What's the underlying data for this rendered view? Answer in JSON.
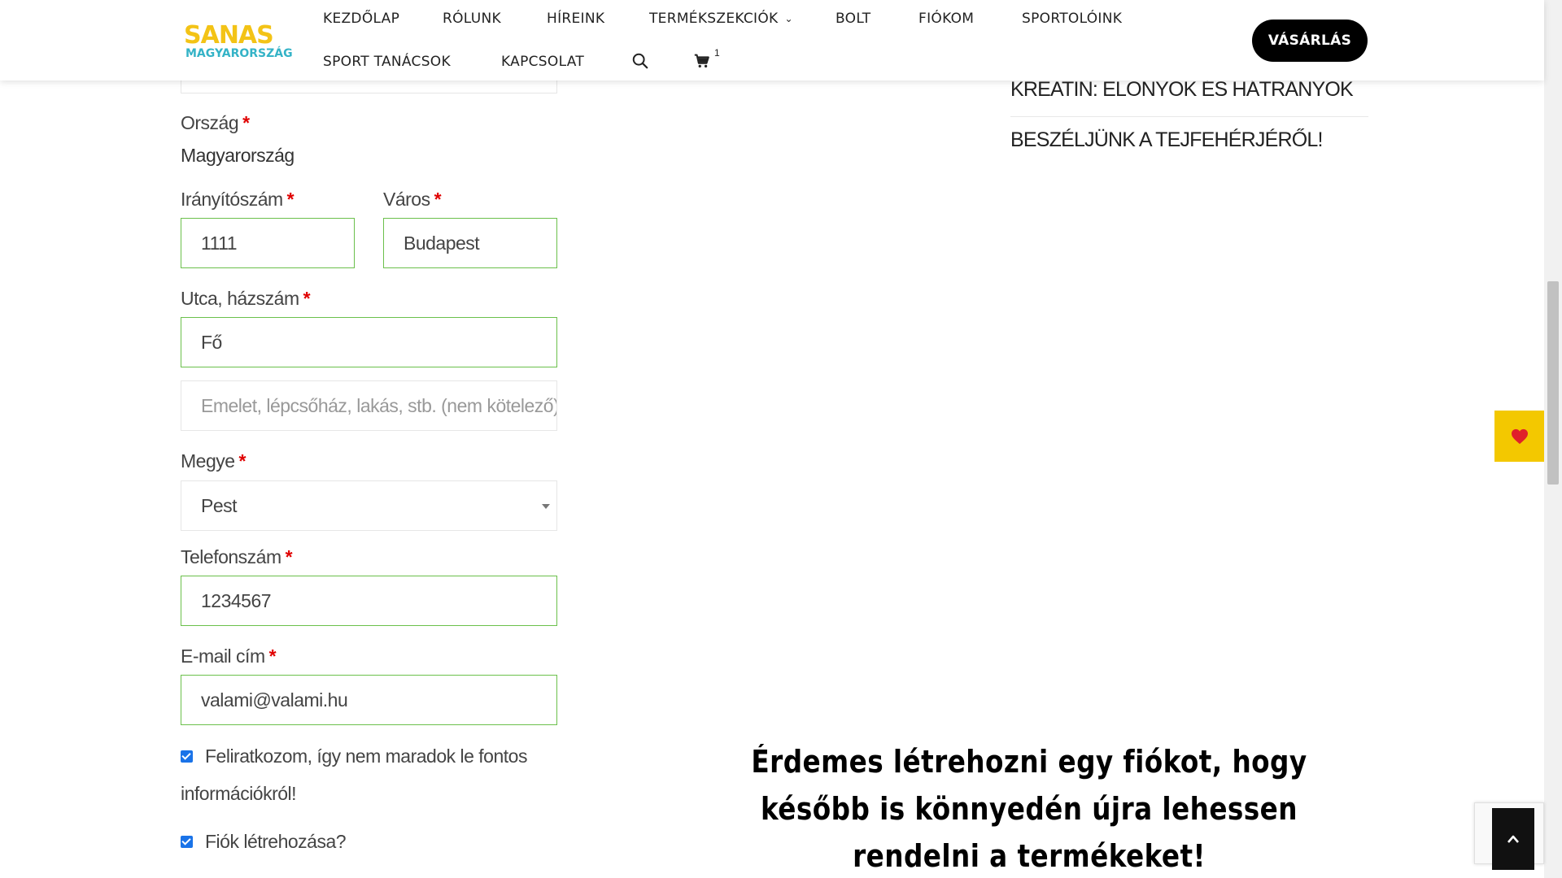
{
  "header": {
    "logo_top": "SANAS",
    "logo_bottom": "MAGYARORSZÁG",
    "nav": {
      "home": "KEZDŐLAP",
      "about": "RÓLUNK",
      "news": "HÍREINK",
      "products": "TERMÉKSZEKCIÓK",
      "shop": "BOLT",
      "account": "FIÓKOM",
      "athletes": "SPORTOLÓINK",
      "tips": "SPORT TANÁCSOK",
      "contact": "KAPCSOLAT"
    },
    "cart_count": "1",
    "buy_label": "VÁSÁRLÁS"
  },
  "form": {
    "country_label": "Ország",
    "country_value": "Magyarország",
    "zip_label": "Irányítószám",
    "zip_value": "1111",
    "city_label": "Város",
    "city_value": "Budapest",
    "street_label": "Utca, házszám",
    "street_value": "Fő",
    "address2_placeholder": "Emelet, lépcsőház, lakás, stb. (nem kötelező)",
    "county_label": "Megye",
    "county_value": "Pest",
    "phone_label": "Telefonszám",
    "phone_value": "1234567",
    "email_label": "E-mail cím",
    "email_value": "valami@valami.hu",
    "newsletter_label": "Feliratkozom, így nem maradok le fontos információkról!",
    "create_account_label": "Fiók létrehozása?",
    "required_mark": "*"
  },
  "sidebar": {
    "links": [
      "KREATIN: ELŐNYÖK ÉS HÁTRÁNYOK",
      "BESZÉLJÜNK A TEJFEHÉRJÉRŐL!"
    ]
  },
  "caption": "Érdemes létrehozni egy fiókot, hogy később is könnyedén újra lehessen rendelni a termékeket!",
  "colors": {
    "accent_green": "#6bc04b",
    "required_red": "#e00000",
    "brand_yellow": "#f3c316",
    "brand_teal": "#34b3c7"
  }
}
